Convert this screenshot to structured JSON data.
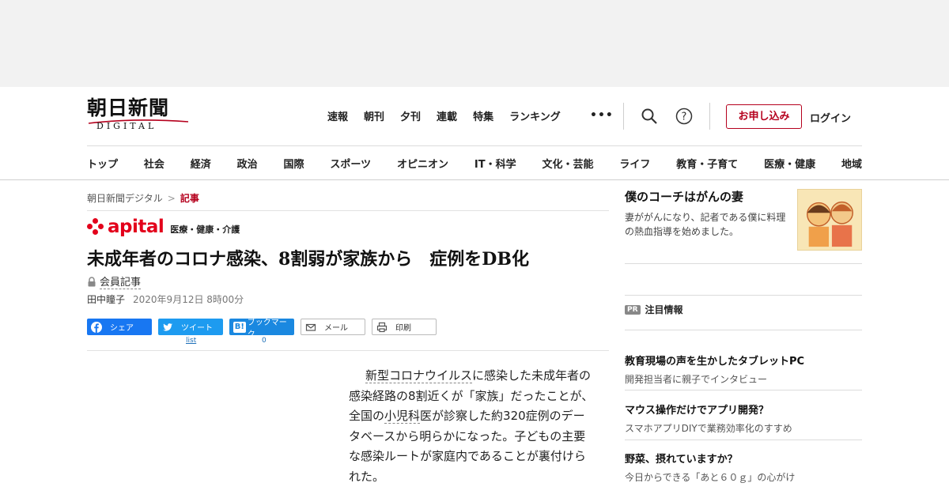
{
  "logo": {
    "main": "朝日新聞",
    "sub": "DIGITAL"
  },
  "topnav": [
    "速報",
    "朝刊",
    "夕刊",
    "連載",
    "特集",
    "ランキング"
  ],
  "header_actions": {
    "more": "•••",
    "apply": "お申し込み",
    "login": "ログイン"
  },
  "icons": {
    "search": "search-icon",
    "help": "help-icon",
    "lock": "lock-icon"
  },
  "secnav": [
    "トップ",
    "社会",
    "経済",
    "政治",
    "国際",
    "スポーツ",
    "オピニオン",
    "IT・科学",
    "文化・芸能",
    "ライフ",
    "教育・子育て",
    "医療・健康",
    "地域"
  ],
  "breadcrumb": {
    "home": "朝日新聞デジタル",
    "sep": ">",
    "current": "記事"
  },
  "apital": {
    "word": "apital",
    "category": "医療・健康・介護"
  },
  "article": {
    "title": "未成年者のコロナ感染、8割弱が家族から　症例をDB化",
    "member_label": "会員記事",
    "author": "田中瞳子",
    "date": "2020年9月12日 8時00分",
    "body": {
      "p1": "新型コロナウイルス",
      "p2": "に感染した未成年者の感染経路の8割近くが「家族」だったことが、全国の",
      "p3": "小児科",
      "p4": "医が診察した約320症例のデータベースから明らかになった。子どもの主要な感染ルートが家庭内であることが裏付けられた。"
    }
  },
  "share": {
    "facebook": "シェア",
    "twitter": "ツイート",
    "hatena": "ブックマーク",
    "hatena_icon": "B!",
    "mail": "メール",
    "print": "印刷",
    "twitter_count": "list",
    "hatena_count": "0"
  },
  "sidebar": {
    "promo": {
      "title": "僕のコーチはがんの妻",
      "desc": "妻ががんになり、記者である僕に料理の熱血指導を始めました。"
    },
    "pr_badge": "PR",
    "pr_label": "注目情報",
    "ads": [
      {
        "title": "教育現場の声を生かしたタブレットPC",
        "desc": "開発担当者に親子でインタビュー"
      },
      {
        "title": "マウス操作だけでアプリ開発？",
        "desc": "スマホアプリDIYで業務効率化のすすめ"
      },
      {
        "title": "野菜、摂れていますか？",
        "desc": "今日からできる「あと６０ｇ」の心がけ"
      }
    ]
  },
  "colors": {
    "brand_red": "#b5001d",
    "apital_red": "#e3001b",
    "facebook": "#1877f2",
    "twitter": "#1d9bf0"
  }
}
